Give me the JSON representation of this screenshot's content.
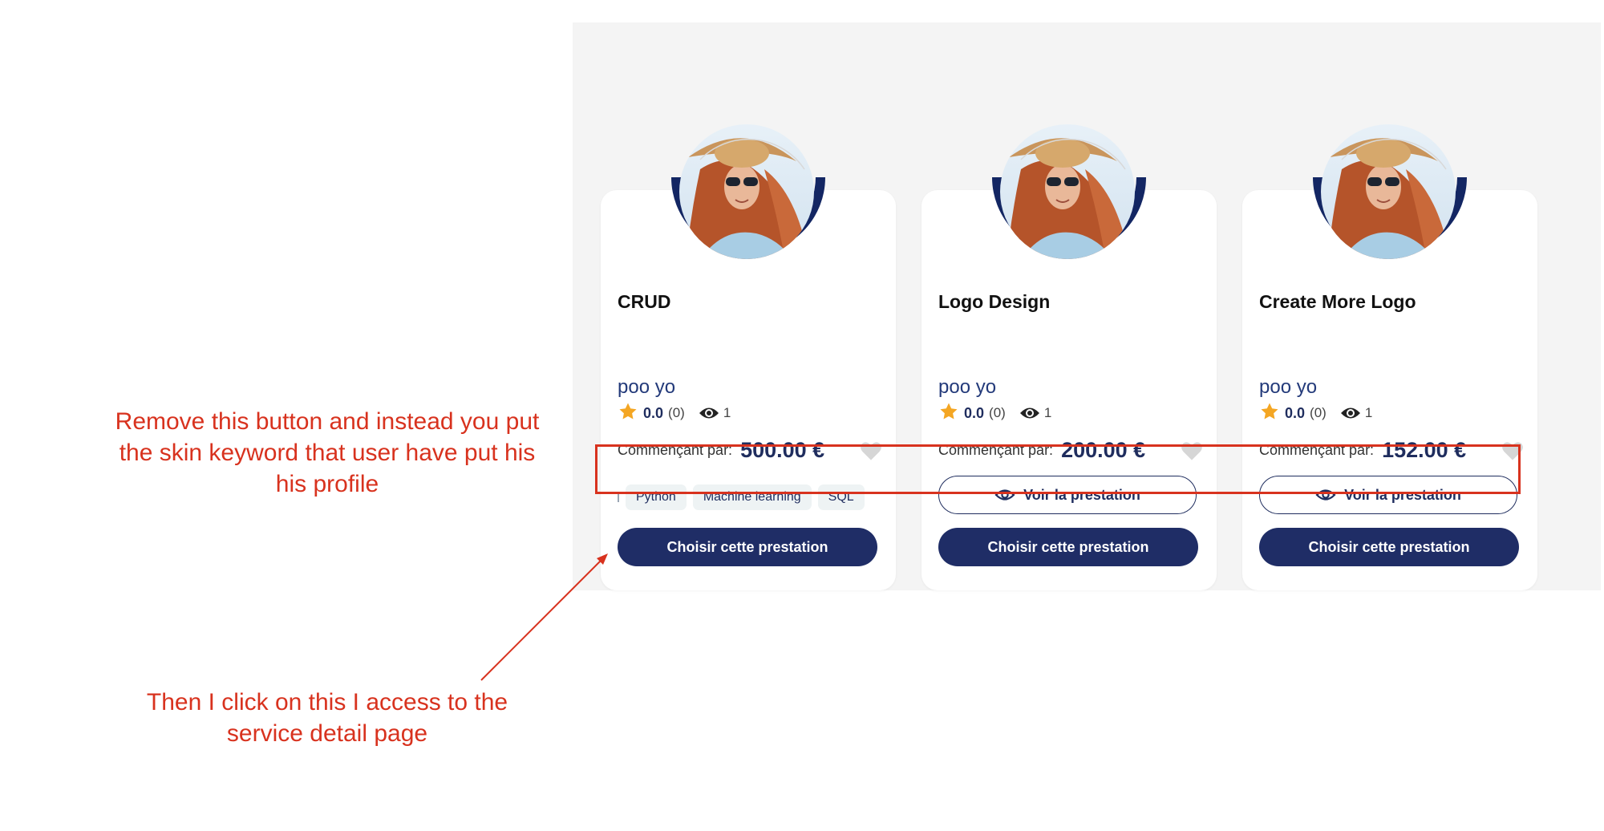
{
  "cards": [
    {
      "title": "CRUD",
      "author": "poo yo",
      "rating": "0.0",
      "rating_count": "(0)",
      "views": "1",
      "price_label": "Commençant par:",
      "price": "500.00 €",
      "tags": [
        "Python",
        "Machine learning",
        "SQL"
      ],
      "primary_button": "Choisir cette prestation"
    },
    {
      "title": "Logo Design",
      "author": "poo yo",
      "rating": "0.0",
      "rating_count": "(0)",
      "views": "1",
      "price_label": "Commençant par:",
      "price": "200.00 €",
      "secondary_button": "Voir la prestation",
      "primary_button": "Choisir cette prestation"
    },
    {
      "title": "Create More Logo",
      "author": "poo yo",
      "rating": "0.0",
      "rating_count": "(0)",
      "views": "1",
      "price_label": "Commençant par:",
      "price": "152.00 €",
      "secondary_button": "Voir la prestation",
      "primary_button": "Choisir cette prestation"
    }
  ],
  "annotations": {
    "top": "Remove this button and instead you put the skin keyword that user have put his his profile",
    "bottom": "Then I click on this I access to the service detail page"
  },
  "colors": {
    "navy": "#1f2d66",
    "star": "#f4a623",
    "annotation_red": "#d8321e",
    "panel_bg": "#f4f4f4"
  },
  "icons": {
    "rating": "star-icon",
    "views": "eye-icon",
    "favorite": "heart-icon"
  }
}
